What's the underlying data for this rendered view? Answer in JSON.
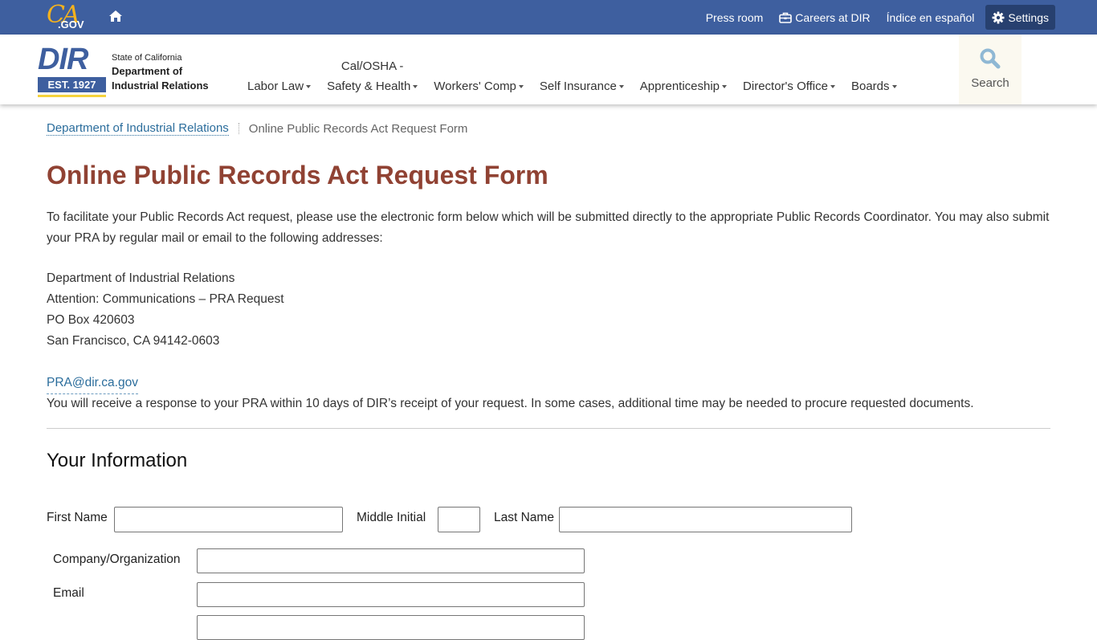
{
  "utility_bar": {
    "logo_text_ca": "CA",
    "logo_text_gov": ".GOV",
    "links": [
      {
        "label": "Press room",
        "icon": ""
      },
      {
        "label": "Careers at DIR",
        "icon": "briefcase-icon"
      },
      {
        "label": "Índice en español",
        "icon": ""
      },
      {
        "label": "Settings",
        "icon": "gear-icon"
      }
    ]
  },
  "header": {
    "logo": {
      "mark": "DIR",
      "est": "EST. 1927",
      "line1": "State of California",
      "line2": "Department of",
      "line3": "Industrial Relations"
    },
    "nav": [
      {
        "label": "Labor Law",
        "pre": ""
      },
      {
        "label": "Safety & Health",
        "pre": "Cal/OSHA -"
      },
      {
        "label": "Workers' Comp",
        "pre": ""
      },
      {
        "label": "Self Insurance",
        "pre": ""
      },
      {
        "label": "Apprenticeship",
        "pre": ""
      },
      {
        "label": "Director's Office",
        "pre": ""
      },
      {
        "label": "Boards",
        "pre": ""
      }
    ],
    "search_label": "Search"
  },
  "breadcrumb": {
    "home": "Department of Industrial Relations",
    "current": "Online Public Records Act Request Form"
  },
  "page": {
    "title": "Online Public Records Act Request Form",
    "intro": "To facilitate your Public Records Act request, please use the electronic form below which will be submitted directly to the appropriate Public Records Coordinator. You may also submit your PRA by regular mail or email to the following addresses:",
    "address": [
      "Department of Industrial Relations",
      "Attention: Communications – PRA Request",
      "PO Box 420603",
      "San Francisco, CA 94142-0603"
    ],
    "email": "PRA@dir.ca.gov",
    "response_note": "You will receive a response to your PRA within 10 days of DIR’s receipt of your request. In some cases, additional time may be needed to procure requested documents."
  },
  "form": {
    "section_title": "Your Information",
    "fields": {
      "first_name": {
        "label": "First Name",
        "value": ""
      },
      "middle_initial": {
        "label": "Middle Initial",
        "value": ""
      },
      "last_name": {
        "label": "Last Name",
        "value": ""
      },
      "company": {
        "label": "Company/Organization",
        "value": ""
      },
      "email": {
        "label": "Email",
        "value": ""
      }
    }
  }
}
